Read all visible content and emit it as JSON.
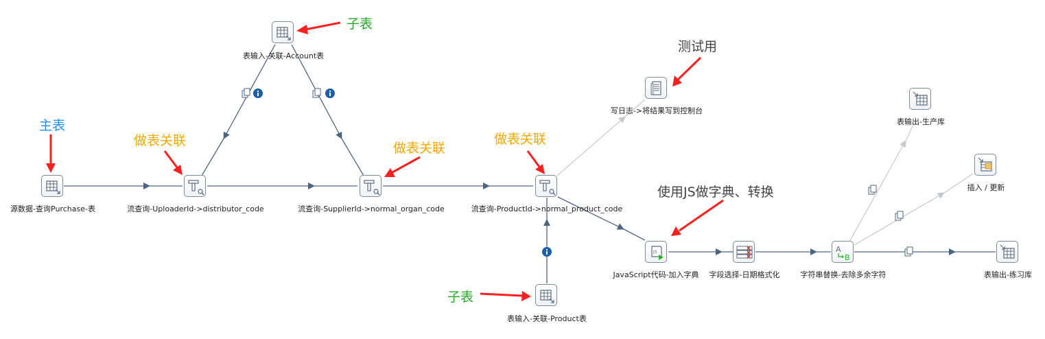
{
  "colors": {
    "hop": "#4d6480",
    "hop_disabled": "#c5c9cf",
    "node_border": "#7d8a9a",
    "info_badge": "#1a5fa8",
    "annotation_arrow": "#ff1f1f",
    "anno_blue": "#1e90ff",
    "anno_orange": "#f5a800",
    "anno_green": "#22aa22",
    "anno_gray": "#444444"
  },
  "nodes": {
    "source": {
      "label": "源数据-查询Purchase-表",
      "icon": "table-input-icon"
    },
    "lookup_uploader": {
      "label": "流查询-UploaderId->distributor_code",
      "icon": "stream-lookup-icon"
    },
    "lookup_supplier": {
      "label": "流查询-SupplierId->normal_organ_code",
      "icon": "stream-lookup-icon"
    },
    "lookup_product": {
      "label": "流查询-ProductId->normal_product_code",
      "icon": "stream-lookup-icon"
    },
    "input_account": {
      "label": "表输入-关联-Account表",
      "icon": "table-input-icon"
    },
    "input_product": {
      "label": "表输入-关联-Product表",
      "icon": "table-input-icon"
    },
    "write_log": {
      "label": "写日志->将结果写到控制台",
      "icon": "log-icon"
    },
    "javascript": {
      "label": "JavaScript代码-加入字典",
      "icon": "javascript-icon"
    },
    "select_values": {
      "label": "字段选择-日期格式化",
      "icon": "select-values-icon"
    },
    "replace_string": {
      "label": "字符串替换-去除多余字符",
      "icon": "replace-string-icon"
    },
    "output_prod": {
      "label": "表输出-生产库",
      "icon": "table-output-icon"
    },
    "insert_update": {
      "label": "插入 / 更新",
      "icon": "insert-update-icon"
    },
    "output_practice": {
      "label": "表输出-练习库",
      "icon": "table-output-icon"
    }
  },
  "annotations": {
    "zi_biao_top": "子表",
    "ce_shi_yong": "测试用",
    "zhu_biao": "主表",
    "zuo_biao_1": "做表关联",
    "zuo_biao_2": "做表关联",
    "zuo_biao_3": "做表关联",
    "shi_yong_js": "使用JS做字典、转换",
    "zi_biao_bottom": "子表"
  }
}
